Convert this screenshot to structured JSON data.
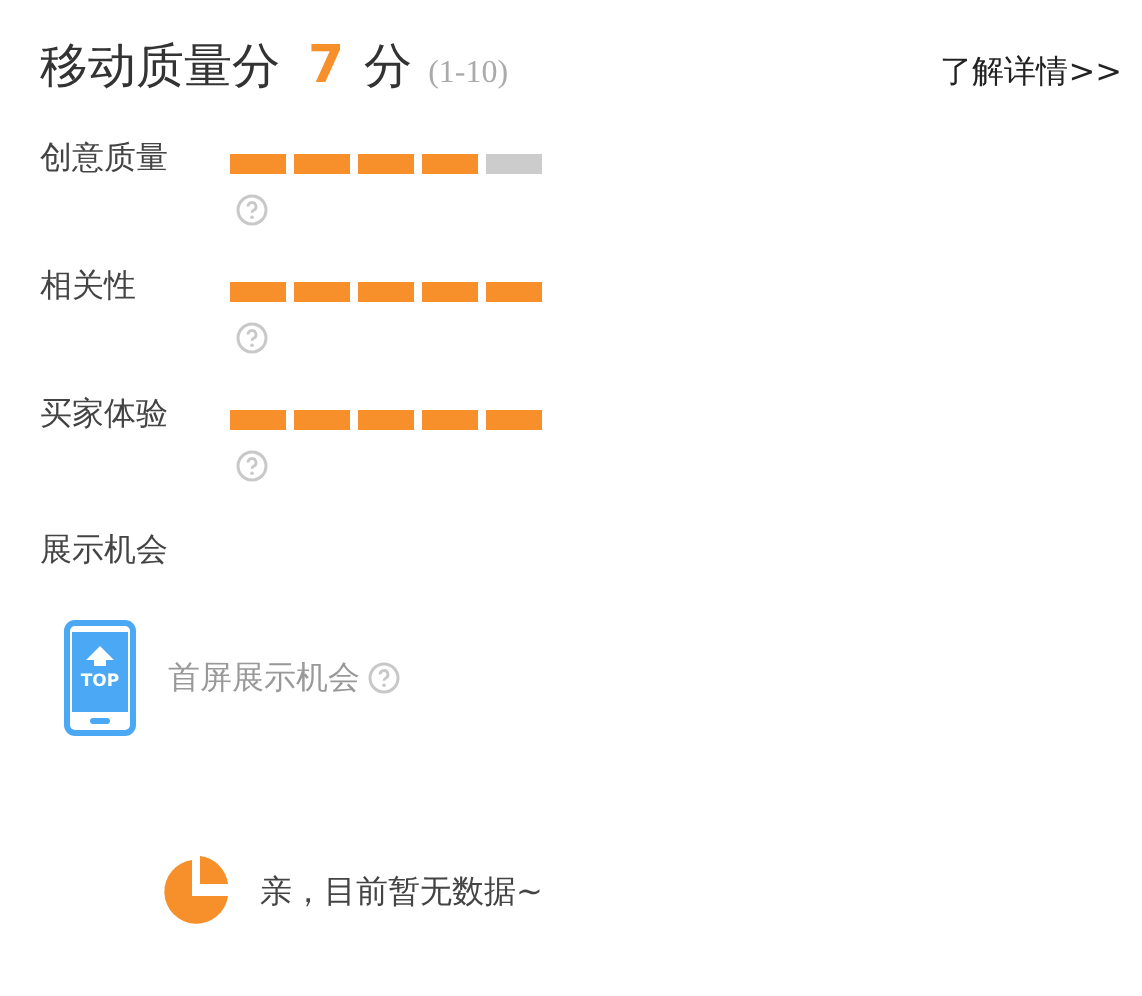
{
  "header": {
    "title": "移动质量分",
    "score": "7",
    "unit": "分",
    "range": "(1-10)",
    "link": "了解详情>>"
  },
  "metrics": [
    {
      "label": "创意质量",
      "stars": 4
    },
    {
      "label": "相关性",
      "stars": 5
    },
    {
      "label": "买家体验",
      "stars": 5
    }
  ],
  "exposure": {
    "title": "展示机会",
    "icon_label": "TOP",
    "item": "首屏展示机会"
  },
  "empty_state": {
    "message": "亲，目前暂无数据~"
  }
}
